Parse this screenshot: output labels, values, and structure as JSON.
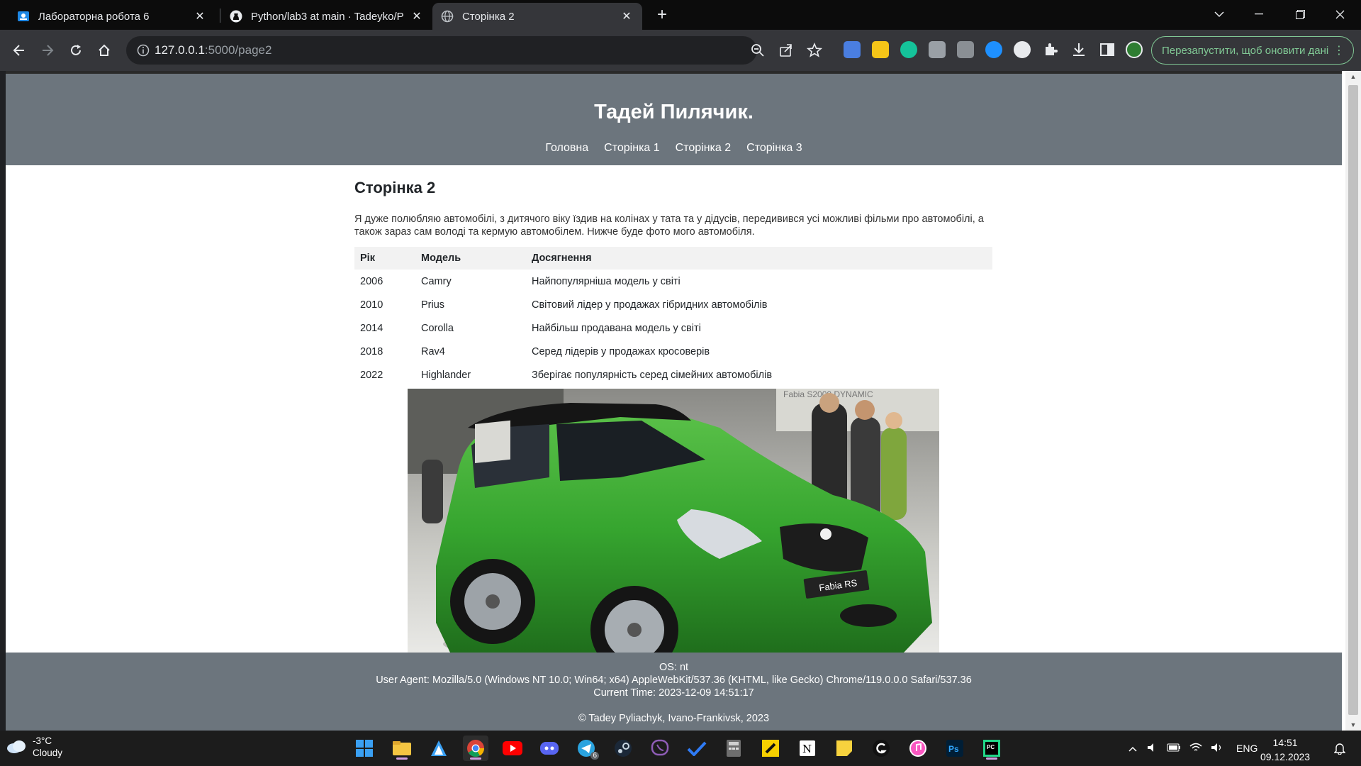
{
  "browser": {
    "tabs": [
      {
        "title": "Лабораторна робота 6",
        "icon": "google-classroom-icon",
        "active": false
      },
      {
        "title": "Python/lab3 at main · Tadeyko/P",
        "icon": "github-icon",
        "active": false
      },
      {
        "title": "Сторінка 2",
        "icon": "globe-icon",
        "active": true
      }
    ],
    "url_host": "127.0.0.1",
    "url_rest": ":5000/page2",
    "update_button": "Перезапустити, щоб оновити дані"
  },
  "page": {
    "site_title": "Тадей Пилячик.",
    "nav": [
      "Головна",
      "Сторінка 1",
      "Сторінка 2",
      "Сторінка 3"
    ],
    "heading": "Сторінка 2",
    "intro": "Я дуже полюбляю автомобілі, з дитячого віку їздив на колінах у тата та у дідусів, передивився усі можливі фільми про автомобілі, а також зараз сам володі та кермую автомобілем. Нижче буде фото мого автомобіля.",
    "table": {
      "headers": [
        "Рік",
        "Модель",
        "Досягнення"
      ],
      "rows": [
        [
          "2006",
          "Camry",
          "Найпопулярніша модель у світі"
        ],
        [
          "2010",
          "Prius",
          "Світовий лідер у продажах гібридних автомобілів"
        ],
        [
          "2014",
          "Corolla",
          "Найбільш продавана модель у світі"
        ],
        [
          "2018",
          "Rav4",
          "Серед лідерів у продажах кросоверів"
        ],
        [
          "2022",
          "Highlander",
          "Зберігає популярність серед сімейних автомобілів"
        ]
      ]
    },
    "photo": {
      "plate_text": "Fabia RS",
      "banner_text": "Fabia S2000  DYNAMIC"
    },
    "footer": {
      "os": "OS: nt",
      "user_agent": "User Agent: Mozilla/5.0 (Windows NT 10.0; Win64; x64) AppleWebKit/537.36 (KHTML, like Gecko) Chrome/119.0.0.0 Safari/537.36",
      "time": "Current Time: 2023-12-09 14:51:17",
      "copyright": "© Tadey Pyliachyk, Ivano-Frankivsk, 2023"
    }
  },
  "taskbar": {
    "weather_temp": "-3°C",
    "weather_desc": "Cloudy",
    "telegram_badge": "6",
    "language": "ENG",
    "time": "14:51",
    "date": "09.12.2023"
  },
  "colors": {
    "header_bg": "#6c757d",
    "car_green": "#3fa83a",
    "update_accent": "#81c995"
  }
}
